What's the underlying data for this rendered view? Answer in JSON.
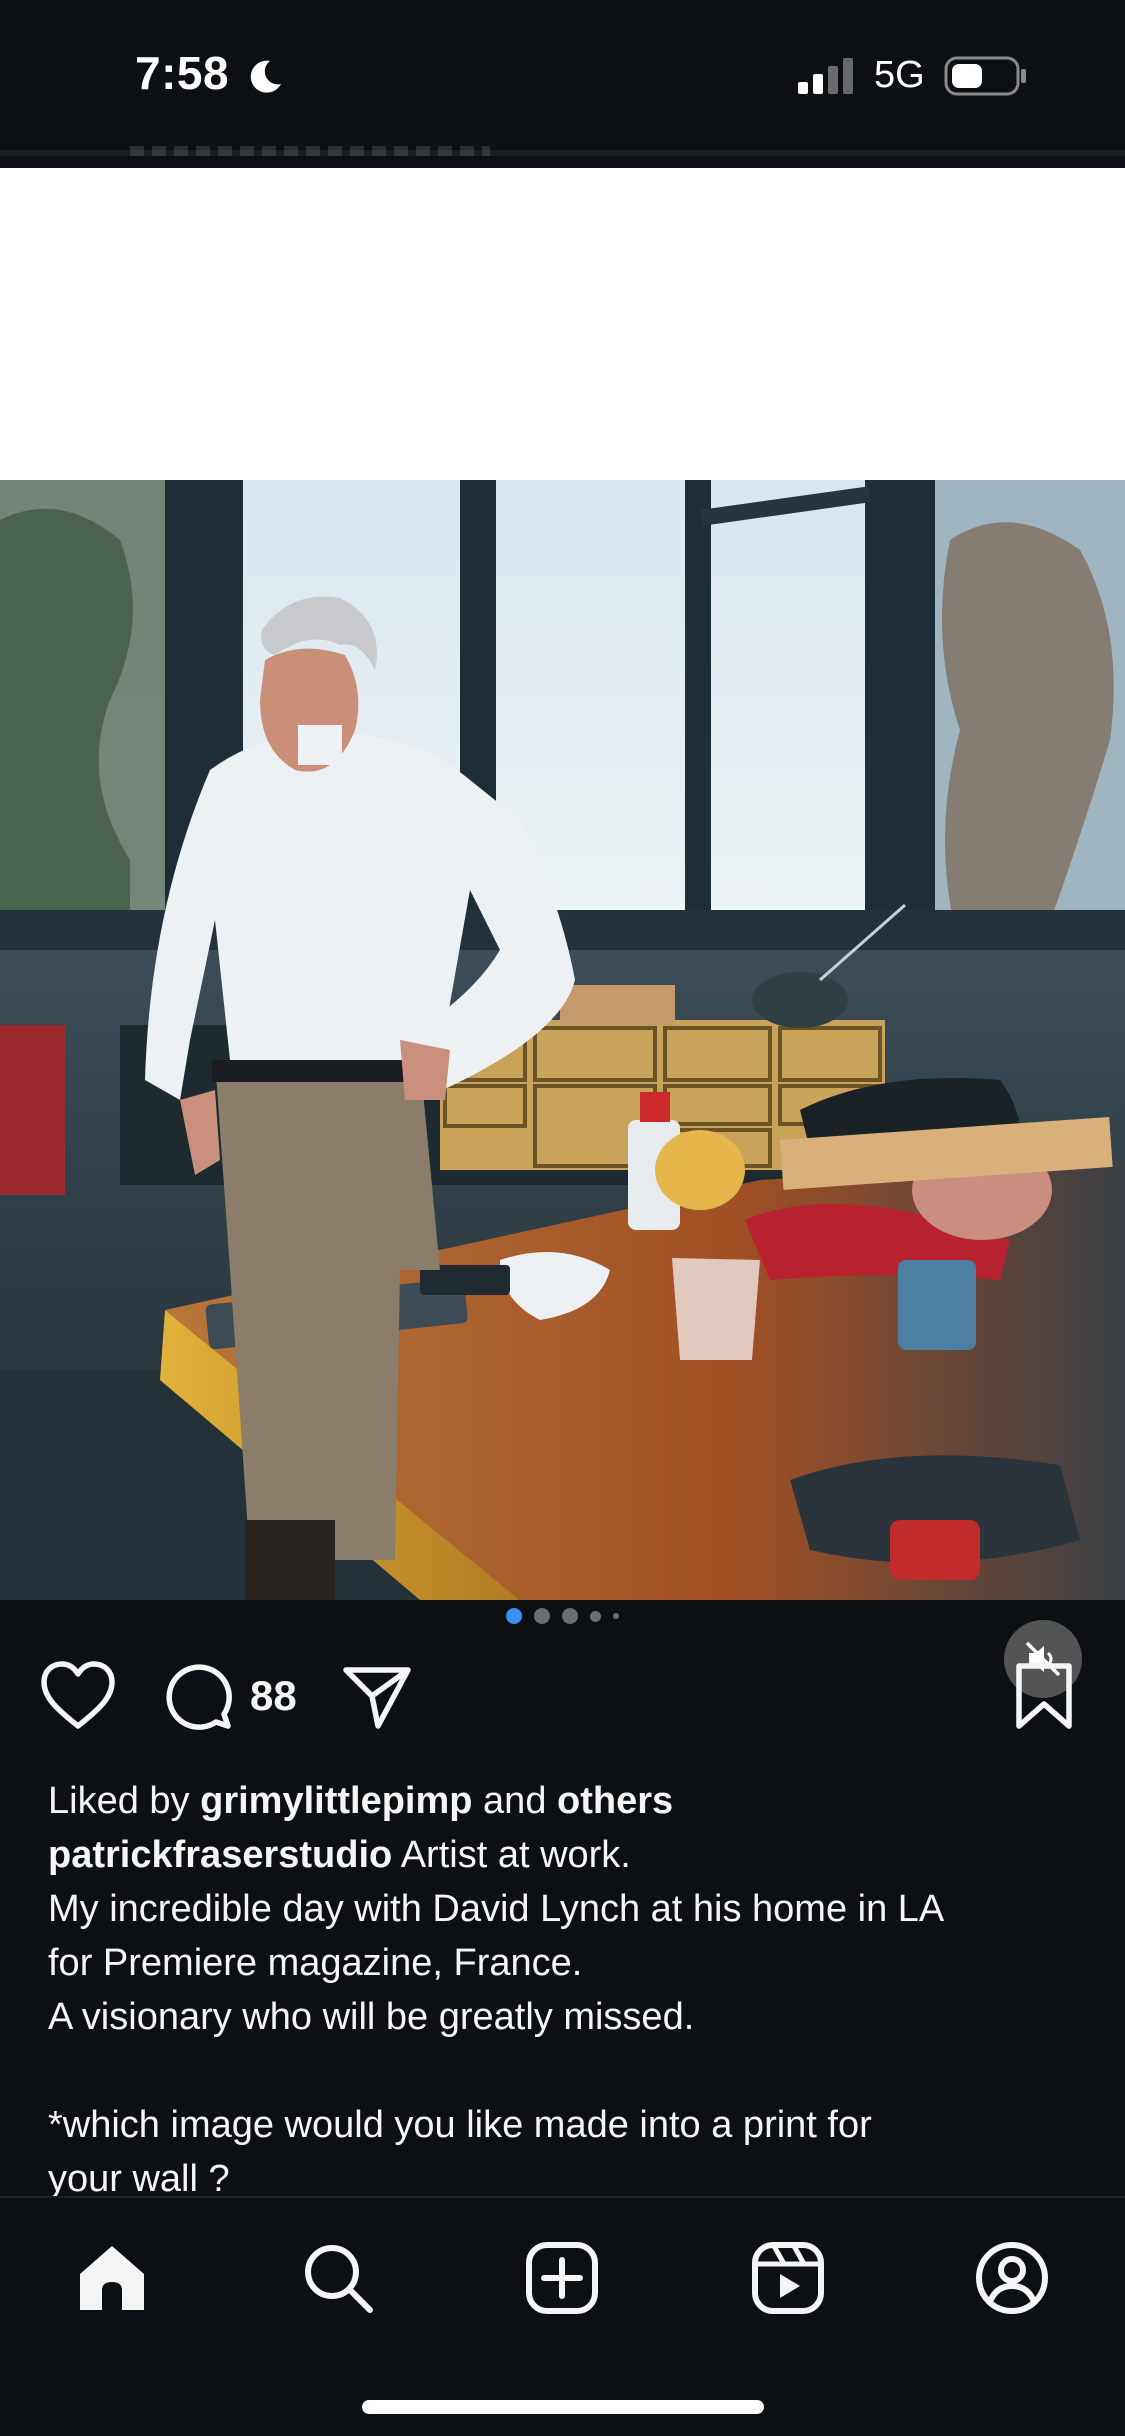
{
  "status_bar": {
    "time": "7:58",
    "moon_icon": "moon-icon",
    "signal_icon": "cellular-signal-icon",
    "network": "5G",
    "battery_icon": "battery-icon"
  },
  "post": {
    "media": {
      "description_icon": "photo",
      "mute_icon": "speaker-muted-icon"
    },
    "carousel": {
      "total_dots_visible": 5,
      "active_index": 0,
      "accent_color": "#3d8ff7"
    },
    "actions": {
      "like_icon": "heart-icon",
      "comment_icon": "comment-bubble-icon",
      "comment_count": "88",
      "share_icon": "paper-plane-icon",
      "save_icon": "bookmark-icon"
    },
    "likes": {
      "prefix": "Liked by",
      "user": "grimylittlepimp",
      "connector": "and",
      "others": "others"
    },
    "caption": {
      "username": "patrickfraserstudio",
      "title": "Artist at work.",
      "line1": "My incredible day with David Lynch at his home in LA",
      "line2": "for Premiere magazine, France.",
      "line3": "A visionary who will be greatly missed.",
      "line4": "*which image would you like made into a print for",
      "line5": "your wall ?"
    }
  },
  "bottom_nav": {
    "items": [
      {
        "name": "home",
        "icon": "home-icon",
        "active": true
      },
      {
        "name": "search",
        "icon": "search-icon",
        "active": false
      },
      {
        "name": "create",
        "icon": "plus-square-icon",
        "active": false
      },
      {
        "name": "reels",
        "icon": "reels-icon",
        "active": false
      },
      {
        "name": "profile",
        "icon": "profile-icon",
        "active": false
      }
    ]
  },
  "colors": {
    "background": "#0c1014",
    "text": "#f5f5f5",
    "accent": "#3d8ff7"
  }
}
